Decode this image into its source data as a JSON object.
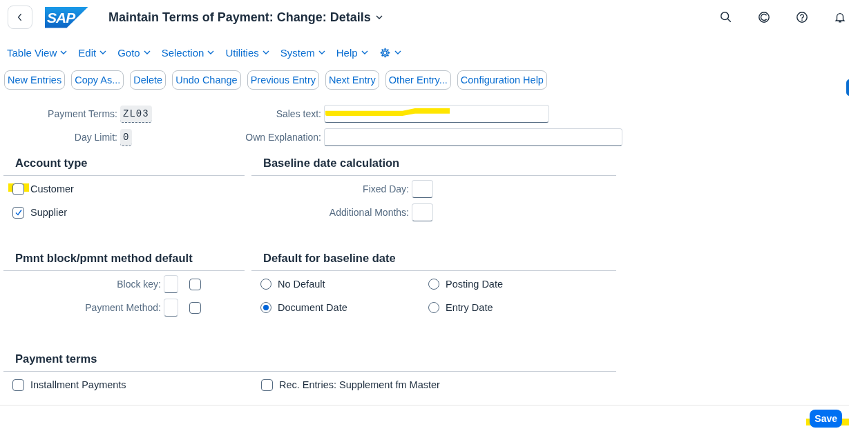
{
  "header": {
    "logo": "SAP",
    "title": "Maintain Terms of Payment: Change: Details"
  },
  "menu": [
    {
      "label": "Table View"
    },
    {
      "label": "Edit"
    },
    {
      "label": "Goto"
    },
    {
      "label": "Selection"
    },
    {
      "label": "Utilities"
    },
    {
      "label": "System"
    },
    {
      "label": "Help"
    }
  ],
  "toolbar": [
    "New Entries",
    "Copy As...",
    "Delete",
    "Undo Change",
    "Previous Entry",
    "Next Entry",
    "Other Entry...",
    "Configuration Help"
  ],
  "key_fields": [
    {
      "label": "Payment Terms:",
      "value": "ZL03"
    },
    {
      "label": "Day Limit:",
      "value": "0"
    }
  ],
  "text_fields": [
    {
      "label": "Sales text:",
      "highlighted": true
    },
    {
      "label": "Own Explanation:",
      "highlighted": false
    }
  ],
  "account_type": {
    "title": "Account type",
    "options": [
      {
        "label": "Customer",
        "checked": false,
        "highlighted": true
      },
      {
        "label": "Supplier",
        "checked": true,
        "highlighted": false
      }
    ]
  },
  "baseline_calc": {
    "title": "Baseline date calculation",
    "fields": [
      {
        "label": "Fixed Day:"
      },
      {
        "label": "Additional Months:"
      }
    ]
  },
  "pmnt_block": {
    "title": "Pmnt block/pmnt method default",
    "fields": [
      {
        "label": "Block key:",
        "checked": false
      },
      {
        "label": "Payment Method:",
        "checked": false
      }
    ]
  },
  "default_baseline": {
    "title": "Default for baseline date",
    "options": [
      {
        "label": "No Default",
        "selected": false
      },
      {
        "label": "Posting Date",
        "selected": false
      },
      {
        "label": "Document Date",
        "selected": true
      },
      {
        "label": "Entry Date",
        "selected": false
      }
    ]
  },
  "payment_terms": {
    "title": "Payment terms",
    "options": [
      {
        "label": "Installment Payments",
        "checked": false
      },
      {
        "label": "Rec. Entries: Supplement fm Master",
        "checked": false
      }
    ]
  },
  "footer": {
    "save": {
      "label": "Save",
      "highlighted": true
    }
  }
}
